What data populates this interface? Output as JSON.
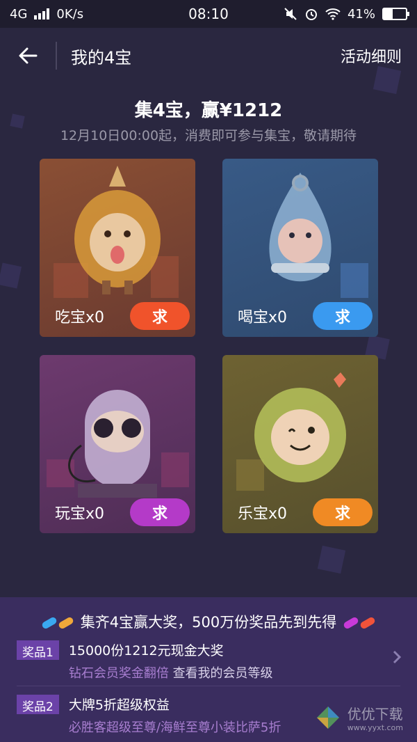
{
  "status_bar": {
    "network": "4G",
    "speed": "0K/s",
    "time": "08:10",
    "battery": "41%",
    "battery_level": 0.41
  },
  "header": {
    "title": "我的4宝",
    "rules_label": "活动细则"
  },
  "banner": {
    "headline": "集4宝，赢¥1212",
    "subtitle": "12月10日00:00起，消费即可参与集宝，敬请期待"
  },
  "cards": [
    {
      "label": "吃宝x0",
      "button": "求",
      "button_color": "#f0532b",
      "mascot_color": "#e4a23a"
    },
    {
      "label": "喝宝x0",
      "button": "求",
      "button_color": "#3a9af0",
      "mascot_color": "#8fb3d3"
    },
    {
      "label": "玩宝x0",
      "button": "求",
      "button_color": "#b43ac8",
      "mascot_color": "#c8b6d8"
    },
    {
      "label": "乐宝x0",
      "button": "求",
      "button_color": "#f08a24",
      "mascot_color": "#b6c25a"
    }
  ],
  "prizes_section": {
    "headline": "集齐4宝赢大奖，500万份奖品先到先得",
    "items": [
      {
        "tag": "奖品1",
        "title": "15000份1212元现金大奖",
        "sub_prefix": "钻石会员奖金翻倍 ",
        "sub_link": "查看我的会员等级"
      },
      {
        "tag": "奖品2",
        "title": "大牌5折超级权益",
        "sub_prefix": "必胜客超级至尊/海鲜至尊小装比萨5折",
        "sub_link": ""
      }
    ]
  },
  "watermark": {
    "text": "优优下载",
    "url": "www.yyxt.com"
  },
  "colors": {
    "background": "#2a2740",
    "prize_panel": "#3a2d5f",
    "tag": "#6b42a8"
  }
}
